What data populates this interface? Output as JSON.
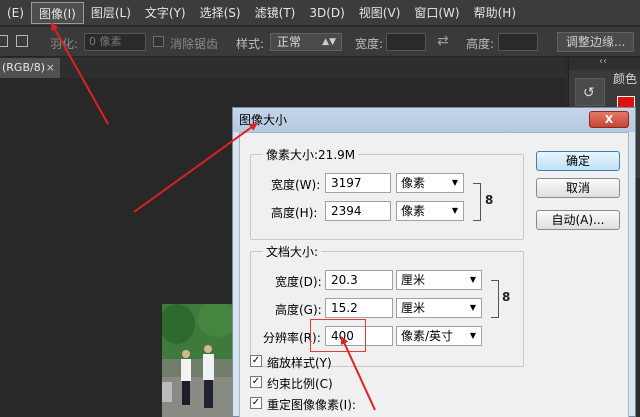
{
  "menubar": {
    "items": [
      "(E)",
      "图像(I)",
      "图层(L)",
      "文字(Y)",
      "选择(S)",
      "滤镜(T)",
      "3D(D)",
      "视图(V)",
      "窗口(W)",
      "帮助(H)"
    ]
  },
  "options": {
    "feather_label": "羽化:",
    "feather_placeholder": "0 像素",
    "antialias_label": "消除锯齿",
    "style_label": "样式:",
    "style_value": "正常",
    "width_label": "宽度:",
    "height_label": "高度:",
    "refine_button": "调整边缘..."
  },
  "document": {
    "tab_label": "(RGB/8)",
    "tab_close": "×"
  },
  "right_panel": {
    "color_label": "颜色",
    "collapse_glyph": "‹‹",
    "swatch_color": "#e01010"
  },
  "dialog": {
    "title": "图像大小",
    "close_glyph": "X",
    "pixel_dimensions_title": "像素大小:21.9M",
    "pixel_width_label": "宽度(W):",
    "pixel_width_value": "3197",
    "pixel_width_unit": "像素",
    "pixel_height_label": "高度(H):",
    "pixel_height_value": "2394",
    "pixel_height_unit": "像素",
    "doc_size_title": "文档大小:",
    "doc_width_label": "宽度(D):",
    "doc_width_value": "20.3",
    "doc_width_unit": "厘米",
    "doc_height_label": "高度(G):",
    "doc_height_value": "15.2",
    "doc_height_unit": "厘米",
    "resolution_label": "分辨率(R):",
    "resolution_value": "400",
    "resolution_unit": "像素/英寸",
    "scale_styles_label": "缩放样式(Y)",
    "constrain_label": "约束比例(C)",
    "resample_label": "重定图像像素(I):",
    "ok_button": "确定",
    "cancel_button": "取消",
    "auto_button": "自动(A)...",
    "checked_glyph": "✓",
    "link_glyph": "8"
  },
  "colors": {
    "annotation_arrow": "#e02020",
    "dialog_bg": "#f0f0f0",
    "ps_dark": "#2b2b2b"
  }
}
